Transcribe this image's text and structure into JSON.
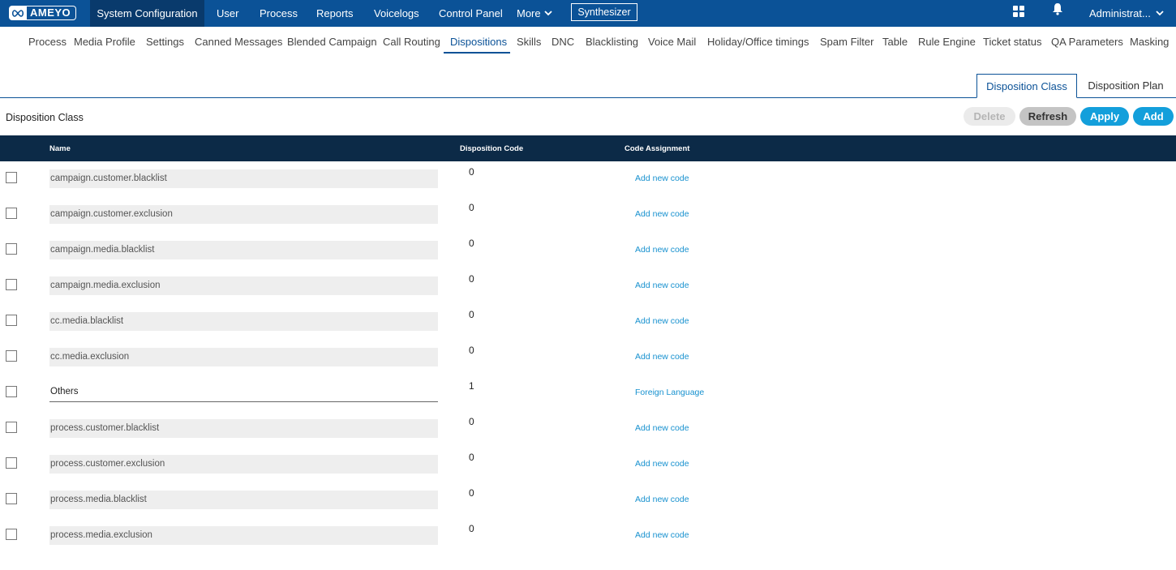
{
  "brand": {
    "logo_text": "AMEYO"
  },
  "topnav": {
    "items": [
      {
        "label": "System Configuration",
        "active": true
      },
      {
        "label": "User"
      },
      {
        "label": "Process"
      },
      {
        "label": "Reports"
      },
      {
        "label": "Voicelogs"
      },
      {
        "label": "Control Panel"
      },
      {
        "label": "More"
      }
    ],
    "synthesizer_label": "Synthesizer",
    "admin_label": "Administrat...",
    "icons": [
      "apps-grid-icon",
      "bell-icon",
      "chevron-down-icon"
    ]
  },
  "subnav": {
    "items": [
      "Process",
      "Media Profile",
      "Settings",
      "Canned Messages",
      "Blended Campaign",
      "Call Routing",
      "Dispositions",
      "Skills",
      "DNC",
      "Blacklisting",
      "Voice Mail",
      "Holiday/Office timings",
      "Spam Filter",
      "Table",
      "Rule Engine",
      "Ticket status",
      "QA Parameters",
      "Masking"
    ],
    "active": "Dispositions"
  },
  "tabs": {
    "active": "Disposition Class",
    "other": "Disposition Plan"
  },
  "section_title": "Disposition Class",
  "buttons": {
    "delete": "Delete",
    "refresh": "Refresh",
    "apply": "Apply",
    "add": "Add"
  },
  "table": {
    "headers": {
      "name": "Name",
      "code": "Disposition Code",
      "assignment": "Code Assignment"
    },
    "rows": [
      {
        "name": "campaign.customer.blacklist",
        "code": "0",
        "assignment": "Add new code"
      },
      {
        "name": "campaign.customer.exclusion",
        "code": "0",
        "assignment": "Add new code"
      },
      {
        "name": "campaign.media.blacklist",
        "code": "0",
        "assignment": "Add new code"
      },
      {
        "name": "campaign.media.exclusion",
        "code": "0",
        "assignment": "Add new code"
      },
      {
        "name": "cc.media.blacklist",
        "code": "0",
        "assignment": "Add new code"
      },
      {
        "name": "cc.media.exclusion",
        "code": "0",
        "assignment": "Add new code"
      },
      {
        "name": "Others",
        "code": "1",
        "assignment": "Foreign Language",
        "editable": true
      },
      {
        "name": "process.customer.blacklist",
        "code": "0",
        "assignment": "Add new code"
      },
      {
        "name": "process.customer.exclusion",
        "code": "0",
        "assignment": "Add new code"
      },
      {
        "name": "process.media.blacklist",
        "code": "0",
        "assignment": "Add new code"
      },
      {
        "name": "process.media.exclusion",
        "code": "0",
        "assignment": "Add new code"
      }
    ]
  },
  "colors": {
    "primary": "#0b5297",
    "header_dark": "#0c2a47",
    "accent": "#139fdb",
    "link": "#1791cf"
  }
}
